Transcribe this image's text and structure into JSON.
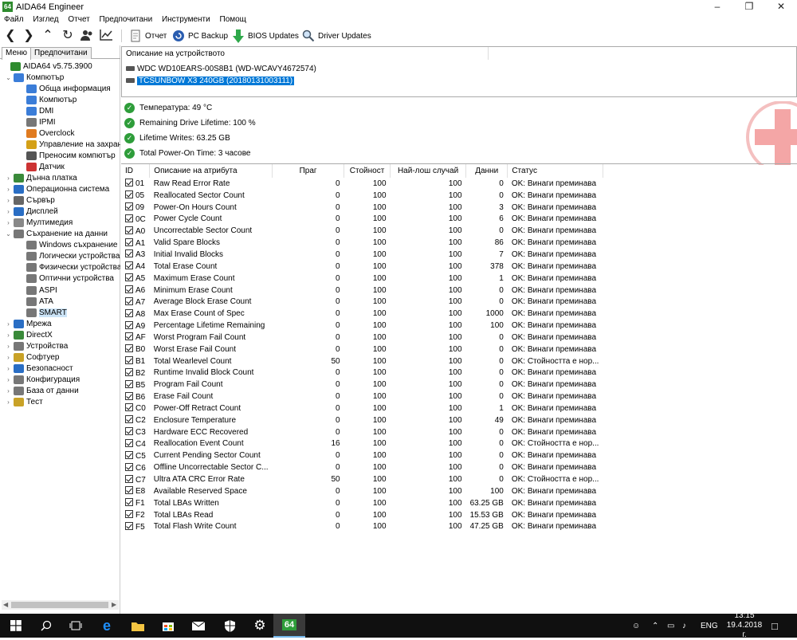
{
  "window": {
    "title": "AIDA64 Engineer",
    "app_icon": "64",
    "minimize": "–",
    "maximize": "❐",
    "close": "✕"
  },
  "menu": [
    "Файл",
    "Изглед",
    "Отчет",
    "Предпочитани",
    "Инструменти",
    "Помощ"
  ],
  "toolbar": {
    "report": "Отчет",
    "pc_backup": "PC Backup",
    "bios_updates": "BIOS Updates",
    "driver_updates": "Driver Updates"
  },
  "left_tabs": [
    "Меню",
    "Предпочитани"
  ],
  "tree": [
    {
      "label": "AIDA64 v5.75.3900",
      "level": 0,
      "icon": "aida-icon",
      "color": "#2e8b2e",
      "exp": ""
    },
    {
      "label": "Компютър",
      "level": 1,
      "icon": "computer-icon",
      "color": "#3b7dd8",
      "exp": "⌄"
    },
    {
      "label": "Обща информация",
      "level": 2,
      "icon": "summary-icon",
      "color": "#3b7dd8",
      "exp": ""
    },
    {
      "label": "Компютър",
      "level": 2,
      "icon": "computer-name-icon",
      "color": "#3b7dd8",
      "exp": ""
    },
    {
      "label": "DMI",
      "level": 2,
      "icon": "dmi-icon",
      "color": "#3b7dd8",
      "exp": ""
    },
    {
      "label": "IPMI",
      "level": 2,
      "icon": "ipmi-icon",
      "color": "#777",
      "exp": ""
    },
    {
      "label": "Overclock",
      "level": 2,
      "icon": "overclock-icon",
      "color": "#e07b20",
      "exp": ""
    },
    {
      "label": "Управление на захран",
      "level": 2,
      "icon": "power-icon",
      "color": "#d4a017",
      "exp": ""
    },
    {
      "label": "Преносим компютър",
      "level": 2,
      "icon": "portable-icon",
      "color": "#555",
      "exp": ""
    },
    {
      "label": "Датчик",
      "level": 2,
      "icon": "sensor-icon",
      "color": "#c33",
      "exp": ""
    },
    {
      "label": "Дънна платка",
      "level": 1,
      "icon": "motherboard-icon",
      "color": "#3a8a3a",
      "exp": "›"
    },
    {
      "label": "Операционна система",
      "level": 1,
      "icon": "os-icon",
      "color": "#2a6ec4",
      "exp": "›"
    },
    {
      "label": "Сървър",
      "level": 1,
      "icon": "server-icon",
      "color": "#666",
      "exp": "›"
    },
    {
      "label": "Дисплей",
      "level": 1,
      "icon": "display-icon",
      "color": "#2a6ec4",
      "exp": "›"
    },
    {
      "label": "Мултимедия",
      "level": 1,
      "icon": "multimedia-icon",
      "color": "#888",
      "exp": "›"
    },
    {
      "label": "Съхранение на данни",
      "level": 1,
      "icon": "storage-icon",
      "color": "#777",
      "exp": "⌄"
    },
    {
      "label": "Windows съхранение",
      "level": 2,
      "icon": "win-storage-icon",
      "color": "#777",
      "exp": ""
    },
    {
      "label": "Логически устройства",
      "level": 2,
      "icon": "logical-drives-icon",
      "color": "#777",
      "exp": ""
    },
    {
      "label": "Физически устройства",
      "level": 2,
      "icon": "physical-drives-icon",
      "color": "#777",
      "exp": ""
    },
    {
      "label": "Оптични устройства",
      "level": 2,
      "icon": "optical-drives-icon",
      "color": "#777",
      "exp": ""
    },
    {
      "label": "ASPI",
      "level": 2,
      "icon": "aspi-icon",
      "color": "#777",
      "exp": ""
    },
    {
      "label": "ATA",
      "level": 2,
      "icon": "ata-icon",
      "color": "#777",
      "exp": ""
    },
    {
      "label": "SMART",
      "level": 2,
      "icon": "smart-icon",
      "color": "#777",
      "exp": "",
      "selected": true
    },
    {
      "label": "Мрежа",
      "level": 1,
      "icon": "network-icon",
      "color": "#2a6ec4",
      "exp": "›"
    },
    {
      "label": "DirectX",
      "level": 1,
      "icon": "directx-icon",
      "color": "#3a8a3a",
      "exp": "›"
    },
    {
      "label": "Устройства",
      "level": 1,
      "icon": "devices-icon",
      "color": "#777",
      "exp": "›"
    },
    {
      "label": "Софтуер",
      "level": 1,
      "icon": "software-icon",
      "color": "#c9a227",
      "exp": "›"
    },
    {
      "label": "Безопасност",
      "level": 1,
      "icon": "security-icon",
      "color": "#2a6ec4",
      "exp": "›"
    },
    {
      "label": "Конфигурация",
      "level": 1,
      "icon": "config-icon",
      "color": "#777",
      "exp": "›"
    },
    {
      "label": "База от данни",
      "level": 1,
      "icon": "database-icon",
      "color": "#777",
      "exp": "›"
    },
    {
      "label": "Тест",
      "level": 1,
      "icon": "benchmark-icon",
      "color": "#c9a227",
      "exp": "›"
    }
  ],
  "devices": {
    "header": "Описание на устройството",
    "items": [
      {
        "label": "WDC WD10EARS-00S8B1 (WD-WCAVY4672574)",
        "selected": false
      },
      {
        "label": "TCSUNBOW X3 240GB (20180131003111)",
        "selected": true
      }
    ]
  },
  "summary": [
    "Температура: 49 °C",
    "Remaining Drive Lifetime: 100 %",
    "Lifetime Writes: 63.25 GB",
    "Total Power-On Time: 3 часове"
  ],
  "table": {
    "headers": [
      "ID",
      "Описание на атрибута",
      "Праг",
      "Стойност",
      "Най-лош случай",
      "Данни",
      "Статус"
    ],
    "rows": [
      [
        "01",
        "Raw Read Error Rate",
        "0",
        "100",
        "100",
        "0",
        "OK: Винаги преминава"
      ],
      [
        "05",
        "Reallocated Sector Count",
        "0",
        "100",
        "100",
        "0",
        "OK: Винаги преминава"
      ],
      [
        "09",
        "Power-On Hours Count",
        "0",
        "100",
        "100",
        "3",
        "OK: Винаги преминава"
      ],
      [
        "0C",
        "Power Cycle Count",
        "0",
        "100",
        "100",
        "6",
        "OK: Винаги преминава"
      ],
      [
        "A0",
        "Uncorrectable Sector Count",
        "0",
        "100",
        "100",
        "0",
        "OK: Винаги преминава"
      ],
      [
        "A1",
        "Valid Spare Blocks",
        "0",
        "100",
        "100",
        "86",
        "OK: Винаги преминава"
      ],
      [
        "A3",
        "Initial Invalid Blocks",
        "0",
        "100",
        "100",
        "7",
        "OK: Винаги преминава"
      ],
      [
        "A4",
        "Total Erase Count",
        "0",
        "100",
        "100",
        "378",
        "OK: Винаги преминава"
      ],
      [
        "A5",
        "Maximum Erase Count",
        "0",
        "100",
        "100",
        "1",
        "OK: Винаги преминава"
      ],
      [
        "A6",
        "Minimum Erase Count",
        "0",
        "100",
        "100",
        "0",
        "OK: Винаги преминава"
      ],
      [
        "A7",
        "Average Block Erase Count",
        "0",
        "100",
        "100",
        "0",
        "OK: Винаги преминава"
      ],
      [
        "A8",
        "Max Erase Count of Spec",
        "0",
        "100",
        "100",
        "1000",
        "OK: Винаги преминава"
      ],
      [
        "A9",
        "Percentage Lifetime Remaining",
        "0",
        "100",
        "100",
        "100",
        "OK: Винаги преминава"
      ],
      [
        "AF",
        "Worst Program Fail Count",
        "0",
        "100",
        "100",
        "0",
        "OK: Винаги преминава"
      ],
      [
        "B0",
        "Worst Erase Fail Count",
        "0",
        "100",
        "100",
        "0",
        "OK: Винаги преминава"
      ],
      [
        "B1",
        "Total Wearlevel Count",
        "50",
        "100",
        "100",
        "0",
        "OK: Стойността е нор..."
      ],
      [
        "B2",
        "Runtime Invalid Block Count",
        "0",
        "100",
        "100",
        "0",
        "OK: Винаги преминава"
      ],
      [
        "B5",
        "Program Fail Count",
        "0",
        "100",
        "100",
        "0",
        "OK: Винаги преминава"
      ],
      [
        "B6",
        "Erase Fail Count",
        "0",
        "100",
        "100",
        "0",
        "OK: Винаги преминава"
      ],
      [
        "C0",
        "Power-Off Retract Count",
        "0",
        "100",
        "100",
        "1",
        "OK: Винаги преминава"
      ],
      [
        "C2",
        "Enclosure Temperature",
        "0",
        "100",
        "100",
        "49",
        "OK: Винаги преминава"
      ],
      [
        "C3",
        "Hardware ECC Recovered",
        "0",
        "100",
        "100",
        "0",
        "OK: Винаги преминава"
      ],
      [
        "C4",
        "Reallocation Event Count",
        "16",
        "100",
        "100",
        "0",
        "OK: Стойността е нор..."
      ],
      [
        "C5",
        "Current Pending Sector Count",
        "0",
        "100",
        "100",
        "0",
        "OK: Винаги преминава"
      ],
      [
        "C6",
        "Offline Uncorrectable Sector C...",
        "0",
        "100",
        "100",
        "0",
        "OK: Винаги преминава"
      ],
      [
        "C7",
        "Ultra ATA CRC Error Rate",
        "50",
        "100",
        "100",
        "0",
        "OK: Стойността е нор..."
      ],
      [
        "E8",
        "Available Reserved Space",
        "0",
        "100",
        "100",
        "100",
        "OK: Винаги преминава"
      ],
      [
        "F1",
        "Total LBAs Written",
        "0",
        "100",
        "100",
        "63.25 GB",
        "OK: Винаги преминава"
      ],
      [
        "F2",
        "Total LBAs Read",
        "0",
        "100",
        "100",
        "15.53 GB",
        "OK: Винаги преминава"
      ],
      [
        "F5",
        "Total Flash Write Count",
        "0",
        "100",
        "100",
        "47.25 GB",
        "OK: Винаги преминава"
      ]
    ]
  },
  "taskbar": {
    "active_app": "64",
    "lang": "ENG",
    "time": "13:15",
    "date": "19.4.2018 г."
  }
}
